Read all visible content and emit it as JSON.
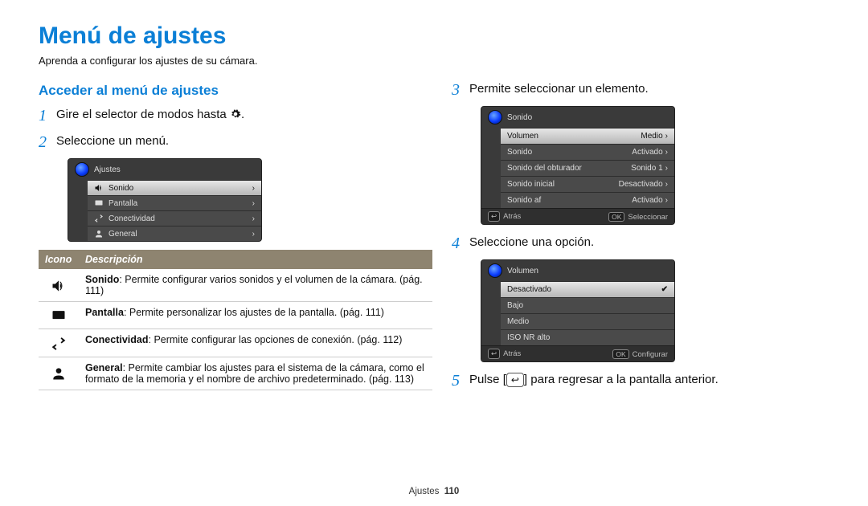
{
  "title": "Menú de ajustes",
  "intro": "Aprenda a configurar los ajustes de su cámara.",
  "section_heading": "Acceder al menú de ajustes",
  "steps_left": {
    "s1_prefix": "Gire el selector de modos hasta ",
    "s1_suffix": ".",
    "s2": "Seleccione un menú."
  },
  "steps_right": {
    "s3": "Permite seleccionar un elemento.",
    "s4": "Seleccione una opción.",
    "s5_prefix": "Pulse [",
    "s5_mid": "↩",
    "s5_suffix": "] para regresar a la pantalla anterior."
  },
  "mock1": {
    "title": "Ajustes",
    "items": [
      "Sonido",
      "Pantalla",
      "Conectividad",
      "General"
    ]
  },
  "mock2": {
    "title": "Sonido",
    "rows": [
      {
        "label": "Volumen",
        "value": "Medio"
      },
      {
        "label": "Sonido",
        "value": "Activado"
      },
      {
        "label": "Sonido del obturador",
        "value": "Sonido 1"
      },
      {
        "label": "Sonido inicial",
        "value": "Desactivado"
      },
      {
        "label": "Sonido af",
        "value": "Activado"
      }
    ],
    "back": "Atrás",
    "ok": "Seleccionar",
    "ok_key": "OK"
  },
  "mock3": {
    "title": "Volumen",
    "options": [
      "Desactivado",
      "Bajo",
      "Medio",
      "ISO NR alto"
    ],
    "back": "Atrás",
    "ok": "Configurar",
    "ok_key": "OK"
  },
  "table": {
    "hdr_icon": "Icono",
    "hdr_desc": "Descripción",
    "rows": [
      {
        "b": "Sonido",
        "t": ": Permite configurar varios sonidos y el volumen de la cámara. (pág. 111)"
      },
      {
        "b": "Pantalla",
        "t": ": Permite personalizar los ajustes de la pantalla. (pág. 111)"
      },
      {
        "b": "Conectividad",
        "t": ": Permite configurar las opciones de conexión. (pág. 112)"
      },
      {
        "b": "General",
        "t": ": Permite cambiar los ajustes para el sistema de la cámara, como el formato de la memoria y el nombre de archivo predeterminado. (pág. 113)"
      }
    ]
  },
  "footer": {
    "section": "Ajustes",
    "page": "110"
  }
}
